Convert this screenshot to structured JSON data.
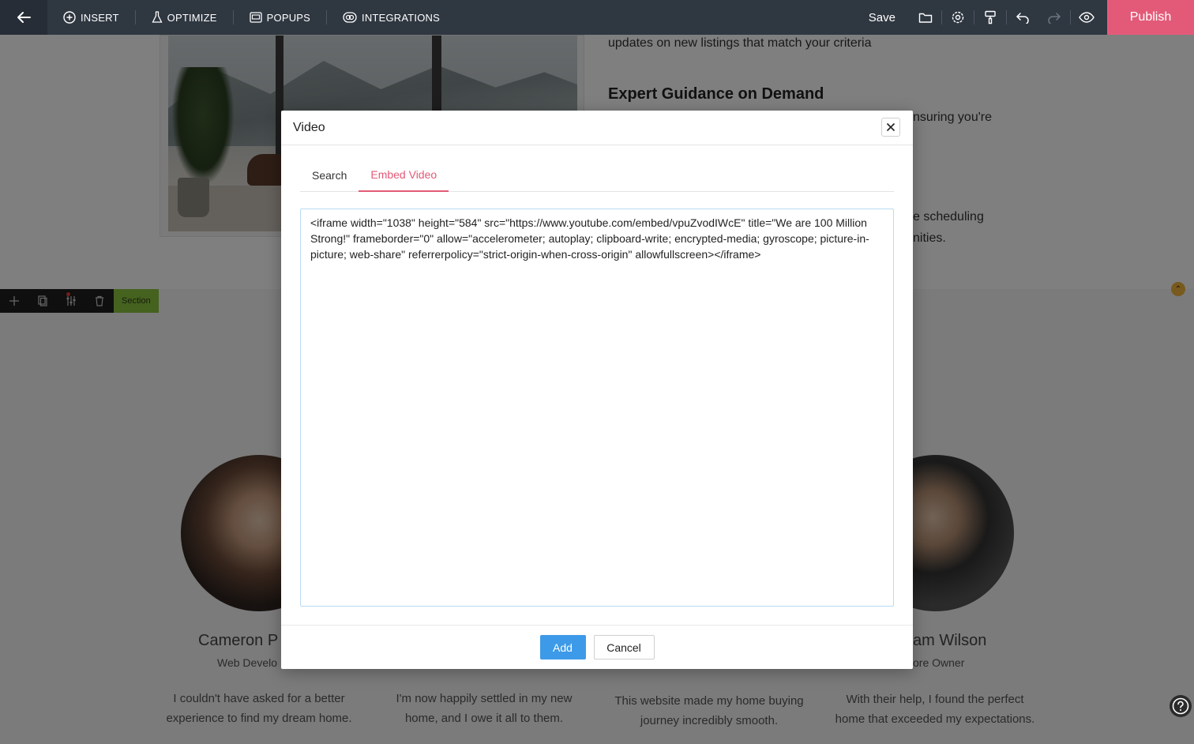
{
  "toolbar": {
    "insert_label": "INSERT",
    "optimize_label": "OPTIMIZE",
    "popups_label": "POPUPS",
    "integrations_label": "INTEGRATIONS",
    "save_label": "Save",
    "publish_label": "Publish"
  },
  "page": {
    "listing_text": "updates on new listings that match your criteria",
    "guidance_title": "Expert Guidance on Demand",
    "fragment_1": "nsuring you're",
    "fragment_2": "e scheduling",
    "fragment_3": "nities.",
    "section_label": "Section",
    "testimonials": [
      {
        "name": "Cameron P",
        "role": "Web Develo",
        "quote": "I couldn't have asked for a better experience to find my dream home."
      },
      {
        "quote": "I'm now happily settled in my new home, and I owe it all to them."
      },
      {
        "quote": "This website made my home buying journey incredibly smooth."
      },
      {
        "name": "am Wilson",
        "role": "ore Owner",
        "quote": "With their help, I found the perfect home that exceeded my expectations."
      }
    ]
  },
  "modal": {
    "title": "Video",
    "tabs": [
      {
        "label": "Search",
        "active": false
      },
      {
        "label": "Embed Video",
        "active": true
      }
    ],
    "embed_code": "<iframe width=\"1038\" height=\"584\" src=\"https://www.youtube.com/embed/vpuZvodIWcE\" title=\"We are 100 Million Strong!\" frameborder=\"0\" allow=\"accelerometer; autoplay; clipboard-write; encrypted-media; gyroscope; picture-in-picture; web-share\" referrerpolicy=\"strict-origin-when-cross-origin\" allowfullscreen></iframe>",
    "add_label": "Add",
    "cancel_label": "Cancel"
  },
  "colors": {
    "toolbar_bg": "#2f3741",
    "publish_bg": "#e35a78",
    "active_tab": "#e35a78",
    "add_button": "#3d9ae8"
  },
  "icons": [
    "back-arrow-icon",
    "plus-circle-icon",
    "flask-icon",
    "popup-icon",
    "integrations-icon",
    "folder-icon",
    "gear-icon",
    "paint-roller-icon",
    "undo-icon",
    "redo-icon",
    "eye-icon",
    "close-icon",
    "move-icon",
    "copy-icon",
    "sliders-icon",
    "trash-icon",
    "help-icon"
  ]
}
